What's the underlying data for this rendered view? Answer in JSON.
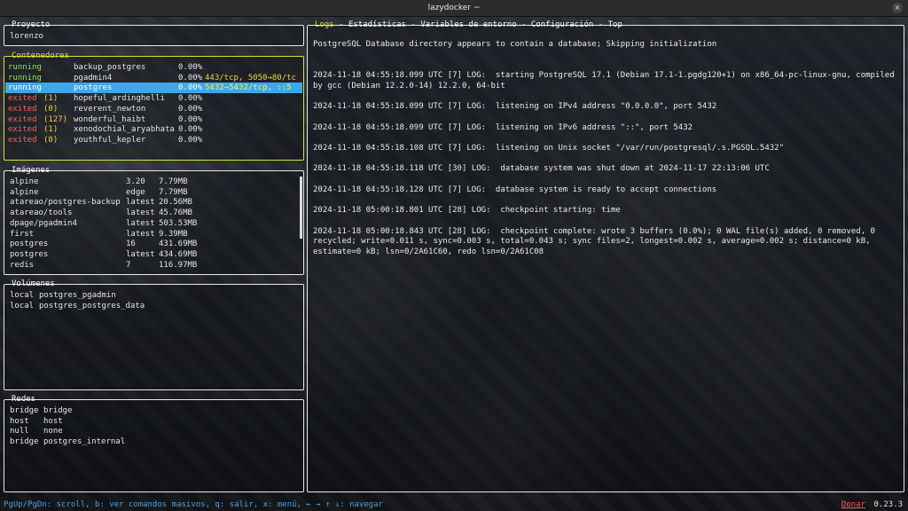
{
  "window": {
    "title": "lazydocker ~",
    "close_icon": "×"
  },
  "proyecto": {
    "title": "Proyecto",
    "name": "lorenzo"
  },
  "contenedores": {
    "title": "Contenedores",
    "rows": [
      {
        "status": "running",
        "code": "",
        "name": "backup_postgres",
        "cpu": "0.00%",
        "ports": ""
      },
      {
        "status": "running",
        "code": "",
        "name": "pgadmin4",
        "cpu": "0.00%",
        "ports": "443/tcp, 5050→80/tc"
      },
      {
        "status": "running",
        "code": "",
        "name": "postgres",
        "cpu": "0.00%",
        "ports": "5432→5432/tcp, ::5"
      },
      {
        "status": "exited",
        "code": "(1)",
        "name": "hopeful_ardinghelli",
        "cpu": "0.00%",
        "ports": ""
      },
      {
        "status": "exited",
        "code": "(0)",
        "name": "reverent_newton",
        "cpu": "0.00%",
        "ports": ""
      },
      {
        "status": "exited",
        "code": "(127)",
        "name": "wonderful_haibt",
        "cpu": "0.00%",
        "ports": ""
      },
      {
        "status": "exited",
        "code": "(1)",
        "name": "xenodochial_aryabhata",
        "cpu": "0.00%",
        "ports": ""
      },
      {
        "status": "exited",
        "code": "(0)",
        "name": "youthful_kepler",
        "cpu": "0.00%",
        "ports": ""
      }
    ],
    "selected_index": 2,
    "colors": {
      "running": "#8ee65c",
      "exited": "#ff5c5c",
      "code": "#f2d43a",
      "selected_bg": "#3fa7e6"
    }
  },
  "imagenes": {
    "title": "Imágenes",
    "rows": [
      {
        "name": "alpine",
        "tag": "3.20",
        "size": "7.79MB"
      },
      {
        "name": "alpine",
        "tag": "edge",
        "size": "7.79MB"
      },
      {
        "name": "atareao/postgres-backup",
        "tag": "latest",
        "size": "20.56MB"
      },
      {
        "name": "atareao/tools",
        "tag": "latest",
        "size": "45.76MB"
      },
      {
        "name": "dpage/pgadmin4",
        "tag": "latest",
        "size": "503.53MB"
      },
      {
        "name": "first",
        "tag": "latest",
        "size": "9.39MB"
      },
      {
        "name": "postgres",
        "tag": "16",
        "size": "431.69MB"
      },
      {
        "name": "postgres",
        "tag": "latest",
        "size": "434.69MB"
      },
      {
        "name": "redis",
        "tag": "7",
        "size": "116.97MB"
      }
    ]
  },
  "volumenes": {
    "title": "Volúmenes",
    "rows": [
      {
        "driver": "local",
        "name": "postgres_pgadmin"
      },
      {
        "driver": "local",
        "name": "postgres_postgres_data"
      }
    ]
  },
  "redes": {
    "title": "Redes",
    "rows": [
      {
        "driver": "bridge",
        "name": "bridge"
      },
      {
        "driver": "host",
        "name": "host"
      },
      {
        "driver": "null",
        "name": "none"
      },
      {
        "driver": "bridge",
        "name": "postgres_internal"
      }
    ]
  },
  "main": {
    "tabs": [
      "Logs",
      "Estadísticas",
      "Variables de entorno",
      "Configuración",
      "Top"
    ],
    "tab_separator": " - ",
    "active_tab": 0,
    "log_lines": [
      "PostgreSQL Database directory appears to contain a database; Skipping initialization",
      "",
      "2024-11-18 04:55:18.099 UTC [7] LOG:  starting PostgreSQL 17.1 (Debian 17.1-1.pgdg120+1) on x86_64-pc-linux-gnu, compiled by gcc (Debian 12.2.0-14) 12.2.0, 64-bit",
      "2024-11-18 04:55:18.099 UTC [7] LOG:  listening on IPv4 address \"0.0.0.0\", port 5432",
      "2024-11-18 04:55:18.099 UTC [7] LOG:  listening on IPv6 address \"::\", port 5432",
      "2024-11-18 04:55:18.108 UTC [7] LOG:  listening on Unix socket \"/var/run/postgresql/.s.PGSQL.5432\"",
      "2024-11-18 04:55:18.118 UTC [30] LOG:  database system was shut down at 2024-11-17 22:13:06 UTC",
      "2024-11-18 04:55:18.128 UTC [7] LOG:  database system is ready to accept connections",
      "2024-11-18 05:00:18.801 UTC [28] LOG:  checkpoint starting: time",
      "2024-11-18 05:00:18.843 UTC [28] LOG:  checkpoint complete: wrote 3 buffers (0.0%); 0 WAL file(s) added, 0 removed, 0 recycled; write=0.011 s, sync=0.003 s, total=0.043 s; sync files=2, longest=0.002 s, average=0.002 s; distance=0 kB, estimate=0 kB; lsn=0/2A61C60, redo lsn=0/2A61C08"
    ]
  },
  "status_bar": {
    "help": "PgUp/PgDn: scroll, b: ver comandos masivos, q: salir, x: menú, ← → ↑ ↓: navegar",
    "donate": "Donar",
    "version": "0.23.3",
    "colors": {
      "help": "#46a3e8",
      "donate": "#ff5c5c"
    }
  }
}
